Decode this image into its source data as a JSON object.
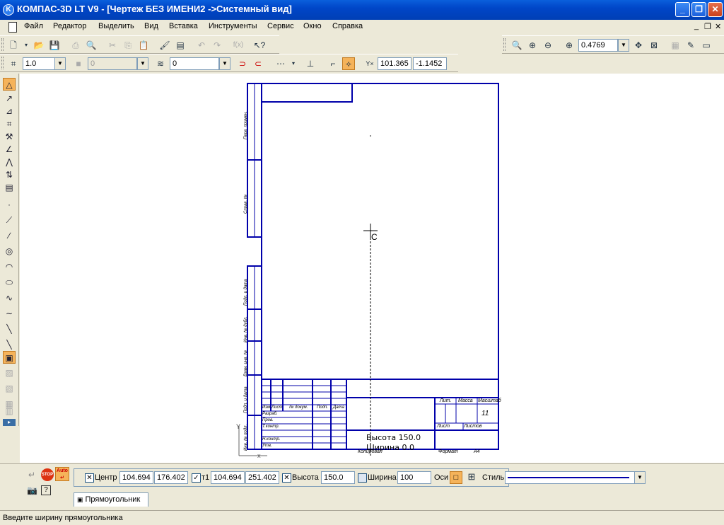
{
  "window": {
    "title": "КОМПАС-3D LT V9 - [Чертеж БЕЗ ИМЕНИ2 ->Системный вид]",
    "minimize": "_",
    "restore": "❐",
    "close": "✕"
  },
  "menu": {
    "items": [
      "Файл",
      "Редактор",
      "Выделить",
      "Вид",
      "Вставка",
      "Инструменты",
      "Сервис",
      "Окно",
      "Справка"
    ],
    "mdi_minimize": "_",
    "mdi_restore": "❐",
    "mdi_close": "✕"
  },
  "view_toolbar": {
    "zoom_value": "0.4769"
  },
  "current_state": {
    "scale_value": "1.0",
    "layer_value": "0",
    "style_value": "0",
    "x_coord": "101.365",
    "y_coord": "-1.1452"
  },
  "drawing": {
    "text_height": "Высота 150.0",
    "text_width": "Ширина 0.0",
    "cursor_marker": "C",
    "sheet_number": "11",
    "stamp_lit": "Лит.",
    "stamp_mass": "Масса",
    "stamp_scale": "Масштаб",
    "stamp_sheet": "Лист",
    "stamp_sheets": "Листов",
    "stamp_copied": "Копировал",
    "stamp_format": "Формат",
    "stamp_format_value": "А4",
    "row_izm": "Изм.",
    "row_list": "Лист",
    "row_doc": "№ докум.",
    "row_podp": "Подп.",
    "row_data": "Дата",
    "row_razrab": "Разраб.",
    "row_prov": "Пров.",
    "row_tkontr": "Т.контр.",
    "row_nkontr": "Н.контр.",
    "row_utv": "Утв.",
    "side_perv": "Перв. примен.",
    "side_sprav": "Справ. №",
    "side_podp_data1": "Подп. и дата",
    "side_inv_dubl": "Инв. № дубл.",
    "side_vzam": "Взам. инв. №",
    "side_podp_data2": "Подп. и дата",
    "side_inv_podl": "Инв. № подл.",
    "axis_y": "Y",
    "axis_x": "X"
  },
  "properties": {
    "center_label": "Центр",
    "center_x": "104.694",
    "center_y": "176.402",
    "t1_label": "т1",
    "t1_x": "104.694",
    "t1_y": "251.402",
    "height_label": "Высота",
    "height_value": "150.0",
    "width_label": "Ширина",
    "width_value": "100",
    "axes_label": "Оси",
    "style_label": "Стиль",
    "auto_label": "Auto",
    "stop_label": "STOP",
    "tab_label": "Прямоугольник"
  },
  "status": {
    "message": "Введите ширину прямоугольника"
  }
}
